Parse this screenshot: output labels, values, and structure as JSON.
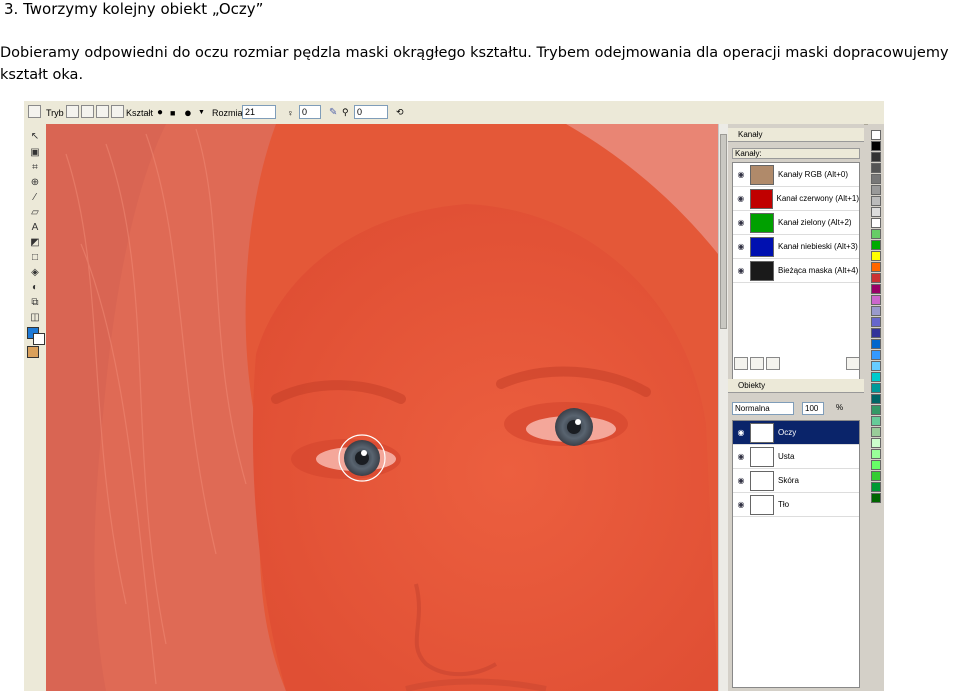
{
  "doc": {
    "heading_number": "3.",
    "heading_text": "Tworzymy kolejny obiekt „Oczy”",
    "paragraph": "Dobieramy odpowiedni do oczu rozmiar pędzla maski okrągłego kształtu. Trybem odejmowania dla operacji maski dopracowujemy kształt oka."
  },
  "toolbar": {
    "mode_label": "Tryb",
    "shape_label": "Kształt",
    "size_label": "Rozmiar",
    "size_value": "21",
    "transparency_value": "0",
    "feather_value": "0"
  },
  "channels_panel": {
    "title": "Kanały",
    "subtitle": "Kanały:",
    "items": [
      {
        "label": "Kanały RGB (Alt+0)",
        "color": "#b08a6a"
      },
      {
        "label": "Kanał czerwony (Alt+1)",
        "color": "#c00000"
      },
      {
        "label": "Kanał zielony (Alt+2)",
        "color": "#00a000"
      },
      {
        "label": "Kanał niebieski (Alt+3)",
        "color": "#0010b0"
      },
      {
        "label": "Bieżąca maska (Alt+4)",
        "color": "#1a1a1a"
      }
    ]
  },
  "objects_panel": {
    "title": "Obiekty",
    "blend_mode": "Normalna",
    "opacity_value": "100",
    "opacity_unit": "%",
    "items": [
      {
        "label": "Oczy",
        "selected": true
      },
      {
        "label": "Usta",
        "selected": false
      },
      {
        "label": "Skóra",
        "selected": false
      },
      {
        "label": "Tło",
        "selected": false
      }
    ]
  },
  "palette_colors": [
    "#ffffff",
    "#000000",
    "#333333",
    "#555555",
    "#777777",
    "#999999",
    "#bbbbbb",
    "#dddddd",
    "#ffffff",
    "#66cc66",
    "#00aa00",
    "#ffff00",
    "#ff6600",
    "#cc3333",
    "#990066",
    "#cc66cc",
    "#9999cc",
    "#6666cc",
    "#333399",
    "#0066cc",
    "#3399ff",
    "#66ccff",
    "#00cccc",
    "#009999",
    "#006666",
    "#339966",
    "#66cc99",
    "#99cc99",
    "#ccffcc",
    "#99ff99",
    "#66ff66",
    "#33cc33",
    "#009933",
    "#006600"
  ]
}
